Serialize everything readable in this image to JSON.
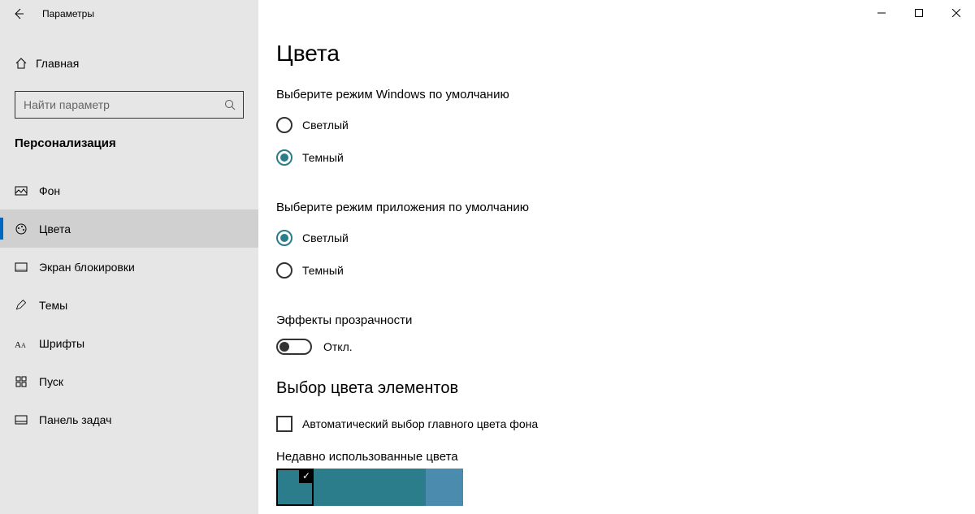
{
  "window": {
    "title": "Параметры"
  },
  "sidebar": {
    "home": "Главная",
    "searchPlaceholder": "Найти параметр",
    "section": "Персонализация",
    "items": [
      {
        "label": "Фон",
        "icon": "picture",
        "active": false
      },
      {
        "label": "Цвета",
        "icon": "palette",
        "active": true
      },
      {
        "label": "Экран блокировки",
        "icon": "lockscreen",
        "active": false
      },
      {
        "label": "Темы",
        "icon": "pencil",
        "active": false
      },
      {
        "label": "Шрифты",
        "icon": "font",
        "active": false
      },
      {
        "label": "Пуск",
        "icon": "start",
        "active": false
      },
      {
        "label": "Панель задач",
        "icon": "taskbar",
        "active": false
      }
    ]
  },
  "page": {
    "title": "Цвета",
    "windowsMode": {
      "label": "Выберите режим Windows по умолчанию",
      "options": [
        {
          "label": "Светлый",
          "checked": false
        },
        {
          "label": "Темный",
          "checked": true
        }
      ]
    },
    "appMode": {
      "label": "Выберите режим приложения по умолчанию",
      "options": [
        {
          "label": "Светлый",
          "checked": true
        },
        {
          "label": "Темный",
          "checked": false
        }
      ]
    },
    "transparency": {
      "label": "Эффекты прозрачности",
      "state": "Откл."
    },
    "accent": {
      "heading": "Выбор цвета элементов",
      "autoLabel": "Автоматический выбор главного цвета фона",
      "autoChecked": false,
      "recentLabel": "Недавно использованные цвета",
      "recent": [
        {
          "hex": "#2b7d8c",
          "selected": true
        },
        {
          "hex": "#2b7d8c",
          "selected": false
        },
        {
          "hex": "#2b7d8c",
          "selected": false
        },
        {
          "hex": "#2b7d8c",
          "selected": false
        },
        {
          "hex": "#4b8bad",
          "selected": false
        }
      ]
    }
  }
}
